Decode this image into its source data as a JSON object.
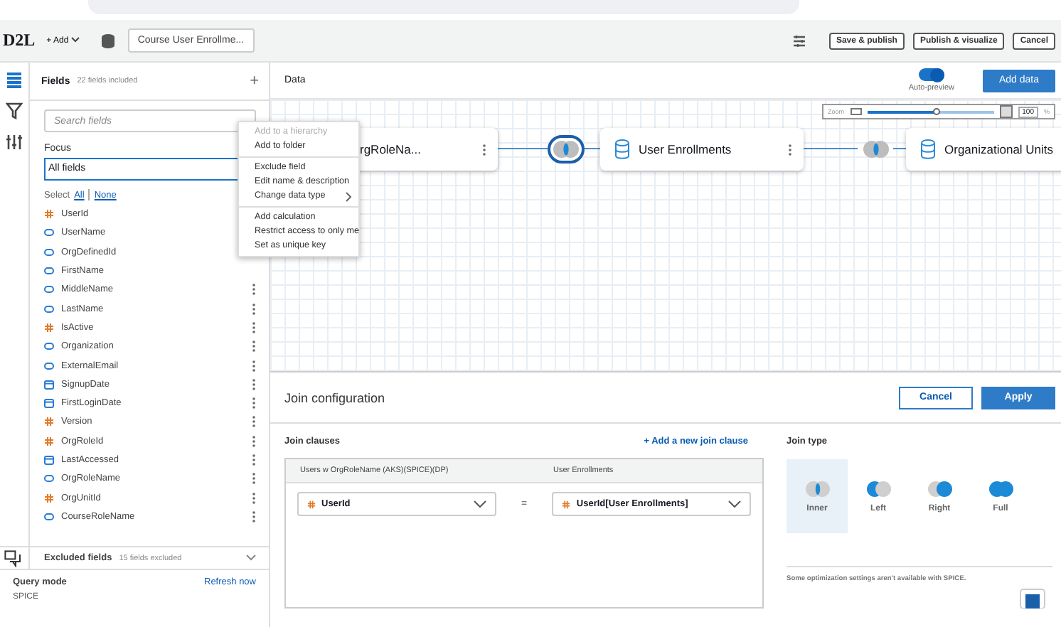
{
  "toolbar": {
    "logo": "D2L",
    "add_label": "+ Add",
    "dataset_tab": "Course User Enrollme...",
    "buttons": [
      "Save & publish",
      "Publish & visualize",
      "Cancel"
    ]
  },
  "rail": {
    "items": [
      {
        "kind": "fields",
        "selected": true
      },
      {
        "kind": "filter",
        "selected": false
      },
      {
        "kind": "params",
        "selected": false
      }
    ]
  },
  "fields_panel": {
    "title": "Fields",
    "count": "22 fields included",
    "add": "+",
    "search": {
      "placeholder": "Search fields"
    },
    "focus_label": "Focus",
    "focus_value": "All fields",
    "select_label": "Select",
    "select_all": "All",
    "select_none": "None",
    "fields": [
      {
        "name": "UserId",
        "kind": "number",
        "more": false
      },
      {
        "name": "UserName",
        "kind": "string",
        "more": false
      },
      {
        "name": "OrgDefinedId",
        "kind": "string",
        "more": false
      },
      {
        "name": "FirstName",
        "kind": "string",
        "more": false
      },
      {
        "name": "MiddleName",
        "kind": "string",
        "more": true
      },
      {
        "name": "LastName",
        "kind": "string",
        "more": true
      },
      {
        "name": "IsActive",
        "kind": "number",
        "more": true
      },
      {
        "name": "Organization",
        "kind": "string",
        "more": true
      },
      {
        "name": "ExternalEmail",
        "kind": "string",
        "more": true
      },
      {
        "name": "SignupDate",
        "kind": "date",
        "more": true
      },
      {
        "name": "FirstLoginDate",
        "kind": "date",
        "more": true
      },
      {
        "name": "Version",
        "kind": "number",
        "more": true
      },
      {
        "name": "OrgRoleId",
        "kind": "number",
        "more": true
      },
      {
        "name": "LastAccessed",
        "kind": "date",
        "more": true
      },
      {
        "name": "OrgRoleName",
        "kind": "string",
        "more": true
      },
      {
        "name": "OrgUnitId",
        "kind": "number",
        "more": true
      },
      {
        "name": "CourseRoleName",
        "kind": "string",
        "more": true
      }
    ],
    "excluded_title": "Excluded fields",
    "excluded_count": "15 fields excluded"
  },
  "query": {
    "label": "Query mode",
    "value": "SPICE",
    "refresh": "Refresh now"
  },
  "context_menu": {
    "groups": [
      [
        {
          "label": "Add to a hierarchy",
          "disabled": true
        },
        {
          "label": "Add to folder",
          "disabled": false
        }
      ],
      [
        {
          "label": "Exclude field",
          "disabled": false
        },
        {
          "label": "Edit name & description",
          "disabled": false
        },
        {
          "label": "Change data type",
          "disabled": false,
          "submenu": true
        }
      ],
      [
        {
          "label": "Add calculation",
          "disabled": false
        },
        {
          "label": "Restrict access to only me",
          "disabled": false
        },
        {
          "label": "Set as unique key",
          "disabled": false
        }
      ]
    ]
  },
  "data_header": {
    "title": "Data",
    "auto_preview": {
      "label": "Auto-preview",
      "on": true
    },
    "add_data": "Add data",
    "zoom": {
      "label": "Zoom",
      "level": 0.55,
      "percent": "100",
      "unit": "%"
    }
  },
  "canvas": {
    "nodes": [
      {
        "label": "rgRoleNa..."
      },
      {
        "label": "User Enrollments"
      },
      {
        "label": "Organizational Units"
      }
    ],
    "joins": [
      {
        "selected": true
      },
      {
        "selected": false
      }
    ]
  },
  "join_config": {
    "title": "Join configuration",
    "cancel": "Cancel",
    "apply": "Apply",
    "clauses_label": "Join clauses",
    "add_clause": "+ Add a new join clause",
    "left_header": "Users w OrgRoleName (AKS)(SPICE)(DP)",
    "right_header": "User Enrollments",
    "clauses": [
      {
        "left": "UserId",
        "op": "=",
        "right": "UserId[User Enrollments]"
      }
    ],
    "type_label": "Join type",
    "types": [
      {
        "label": "Inner",
        "kind": "inner",
        "selected": true
      },
      {
        "label": "Left",
        "kind": "left",
        "selected": false
      },
      {
        "label": "Right",
        "kind": "right",
        "selected": false
      },
      {
        "label": "Full",
        "kind": "full",
        "selected": false
      }
    ],
    "note": "Some optimization settings aren't available with SPICE."
  }
}
